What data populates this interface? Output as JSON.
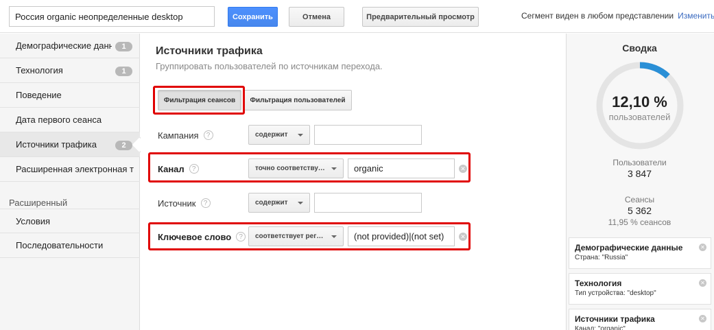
{
  "toolbar": {
    "segment_name": "Россия organic неопределенные desktop",
    "save_label": "Сохранить",
    "cancel_label": "Отмена",
    "preview_label": "Предварительный просмотр",
    "visibility_text": "Сегмент виден в любом представлении",
    "change_link": "Изменить",
    "save_color": "#4d90fe"
  },
  "sidebar": {
    "items": [
      {
        "label": "Демографические данные",
        "badge": "1"
      },
      {
        "label": "Технология",
        "badge": "1"
      },
      {
        "label": "Поведение",
        "badge": ""
      },
      {
        "label": "Дата первого сеанса",
        "badge": ""
      },
      {
        "label": "Источники трафика",
        "badge": "2"
      },
      {
        "label": "Расширенная электронная торговля",
        "badge": ""
      }
    ],
    "section_label": "Расширенный",
    "advanced_items": [
      {
        "label": "Условия"
      },
      {
        "label": "Последовательности"
      }
    ]
  },
  "main": {
    "title": "Источники трафика",
    "subtitle": "Группировать пользователей по источникам перехода.",
    "filter_sessions_label": "Фильтрация сеансов",
    "filter_users_label": "Фильтрация пользователей",
    "help_glyph": "?",
    "rows": [
      {
        "label": "Кампания",
        "operator": "содержит",
        "value": ""
      },
      {
        "label": "Канал",
        "operator": "точно соответствует",
        "value": "organic"
      },
      {
        "label": "Источник",
        "operator": "содержит",
        "value": ""
      },
      {
        "label": "Ключевое слово",
        "operator": "соответствует регулярному выражению",
        "value": "(not provided)|(not set)"
      }
    ],
    "highlight_color": "#e00000"
  },
  "summary": {
    "title": "Сводка",
    "percent": "12,10 %",
    "percent_value": 0.121,
    "percent_unit": "пользователей",
    "users_label": "Пользователи",
    "users_value": "3 847",
    "sessions_label": "Сеансы",
    "sessions_value": "5 362",
    "sessions_note": "11,95 % сеансов",
    "ring_color": "#2a8fd6",
    "ring_track_color": "#e4e4e4",
    "cards": [
      {
        "title": "Демографические данные",
        "desc": "Страна: \"Russia\""
      },
      {
        "title": "Технология",
        "desc": "Тип устройства: \"desktop\""
      },
      {
        "title": "Источники трафика",
        "desc": "Канал: \"organic\""
      }
    ]
  }
}
